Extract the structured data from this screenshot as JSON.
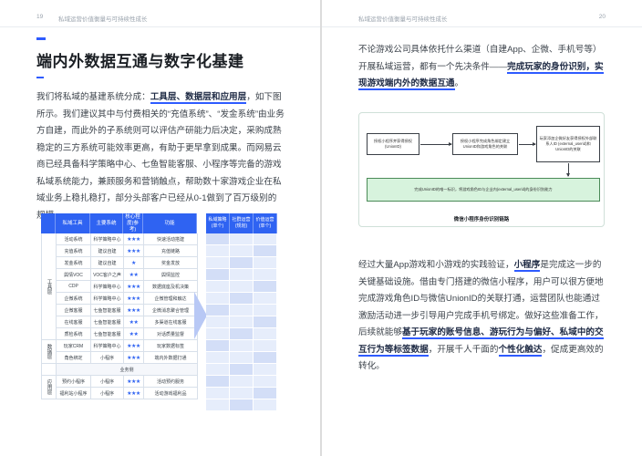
{
  "left_page": {
    "page_number": "19",
    "running_head": "私域运营价值衡量与可持续性成长",
    "title": "端内外数据互通与数字化基建",
    "paragraph_runs": [
      {
        "text": "我们将私域的基建系统分成：",
        "hl": false
      },
      {
        "text": "工具层、数据层和应用层",
        "hl": true
      },
      {
        "text": "，如下图所示。我们建议其中与付费相关的“充值系统”、“发金系统”由业务方自建，而此外的子系统则可以评估产研能力后决定，采购成熟稳定的三方系统可能效率更高，有助于更早拿到成果。而网易云商已经具备科学策略中心、七鱼智能客服、小程序等完备的游戏私域系统能力，兼顾服务和营销触点，帮助数十家游戏企业在私域业务上稳扎稳打，部分头部客户已经从0-1做到了百万级别的规模。",
        "hl": false
      }
    ],
    "table": {
      "headers": [
        "私域工具",
        "主要系统",
        "核心程度(参考)",
        "功能"
      ],
      "groups": [
        {
          "label": "工具层",
          "rows": [
            [
              "活动系统",
              "科学策略中心",
              "★★★",
              "快速活动搭建"
            ],
            [
              "充值系统",
              "建议自建",
              "★★★",
              "充值链路"
            ],
            [
              "发金系统",
              "建议自建",
              "★",
              "奖金发放"
            ],
            [
              "舆情VOC",
              "VOC客户之声",
              "★★",
              "舆情监控"
            ],
            [
              "CDP",
              "科学策略中心",
              "★★★",
              "数据底座及机决策"
            ],
            [
              "企微系统",
              "科学策略中心",
              "★★★",
              "企微管理和触达"
            ],
            [
              "企微客服",
              "七鱼智能客服",
              "★★★",
              "企微消息聚合管理"
            ],
            [
              "在线客服",
              "七鱼智能客服",
              "★★",
              "多渠道在线客服"
            ],
            [
              "质检系统",
              "七鱼智能客服",
              "★★",
              "对话质量监督"
            ]
          ]
        },
        {
          "label": "数据层",
          "rows": [
            [
              "玩家CRM",
              "科学策略中心",
              "★★★",
              "玩家数据标签"
            ],
            [
              "角色绑定",
              "小程序",
              "★★★",
              "端内外数据打通"
            ]
          ]
        },
        {
          "label": "",
          "span_row": "业务侧"
        },
        {
          "label": "应用层",
          "rows": [
            [
              "预约小程序",
              "小程序",
              "★★★",
              "活动预约服务"
            ],
            [
              "福利站小程序",
              "小程序",
              "★★★",
              "活动游戏福利品"
            ]
          ]
        }
      ],
      "side_headers": [
        "私域策略(单个)",
        "社群运营(规划)",
        "价值运营(单个)"
      ],
      "side_row_count": 15
    }
  },
  "right_page": {
    "page_number": "20",
    "running_head": "私域运营价值衡量与可持续性成长",
    "intro_runs": [
      {
        "text": "不论游戏公司具体依托什么渠道（自建App、企微、手机号等）开展私域运营，都有一个先决条件——",
        "hl": false
      },
      {
        "text": "完成玩家的身份识别，实现游戏端内外的数据互通",
        "hl": true
      },
      {
        "text": "。",
        "hl": false
      }
    ],
    "diagram": {
      "box1": "授权小程序并获得授权(UnionID)",
      "box2": "授权小程序完成角色绑定建立UnionID和游戏角色的关联",
      "box3": "玩家添加企微好友获得授权外部联系人ID (external_userid)和UnionID的关联",
      "box4": "完成UnionID的唯一标识，将游戏角色ID与企业内(external_userid)的身份识别能力",
      "caption": "微信小程序身份识别链路"
    },
    "body_runs": [
      {
        "text": "经过大量App游戏和小游戏的实践验证，",
        "hl": false
      },
      {
        "text": "小程序",
        "hl": true
      },
      {
        "text": "是完成这一步的关键基础设施。借由专门搭建的微信小程序，用户可以很方便地完成游戏角色ID与微信UnionID的关联打通，运营团队也能通过激励活动进一步引导用户完成手机号绑定。做好这些准备工作，后续就能够",
        "hl": false
      },
      {
        "text": "基于玩家的账号信息、游玩行为与偏好、私域中的交互行为等标签数据",
        "hl": true
      },
      {
        "text": "，开展千人千面的",
        "hl": false
      },
      {
        "text": "个性化触达",
        "hl": true
      },
      {
        "text": "，促成更高效的转化。",
        "hl": false
      }
    ]
  },
  "colors": {
    "accent": "#2e5bff",
    "table_header": "#2f63f2",
    "star": "#2f63f2",
    "side_cell_light": "#e6edfb",
    "side_cell_mid": "#d3def7",
    "diagram_green": "#d7f3dd"
  }
}
